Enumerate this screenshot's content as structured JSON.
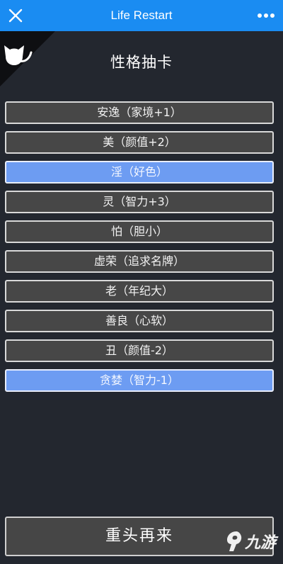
{
  "app": {
    "title": "Life Restart"
  },
  "page": {
    "heading": "性格抽卡"
  },
  "traits": [
    {
      "label": "安逸（家境+1）",
      "selected": false
    },
    {
      "label": "美（颜值+2）",
      "selected": false
    },
    {
      "label": "淫（好色）",
      "selected": true
    },
    {
      "label": "灵（智力+3）",
      "selected": false
    },
    {
      "label": "怕（胆小）",
      "selected": false
    },
    {
      "label": "虚荣（追求名牌）",
      "selected": false
    },
    {
      "label": "老（年纪大）",
      "selected": false
    },
    {
      "label": "善良（心软）",
      "selected": false
    },
    {
      "label": "丑（颜值-2）",
      "selected": false
    },
    {
      "label": "贪婪（智力-1）",
      "selected": true
    }
  ],
  "actions": {
    "restart_label": "重头再来"
  },
  "watermark": {
    "text": "九游"
  },
  "icons": {
    "close": "close-icon",
    "more": "more-dots-icon",
    "corner": "cat-icon"
  },
  "colors": {
    "topbar": "#1a8cf2",
    "background": "#23272f",
    "trait_default": "#474747",
    "trait_selected": "#6d9cf2"
  }
}
